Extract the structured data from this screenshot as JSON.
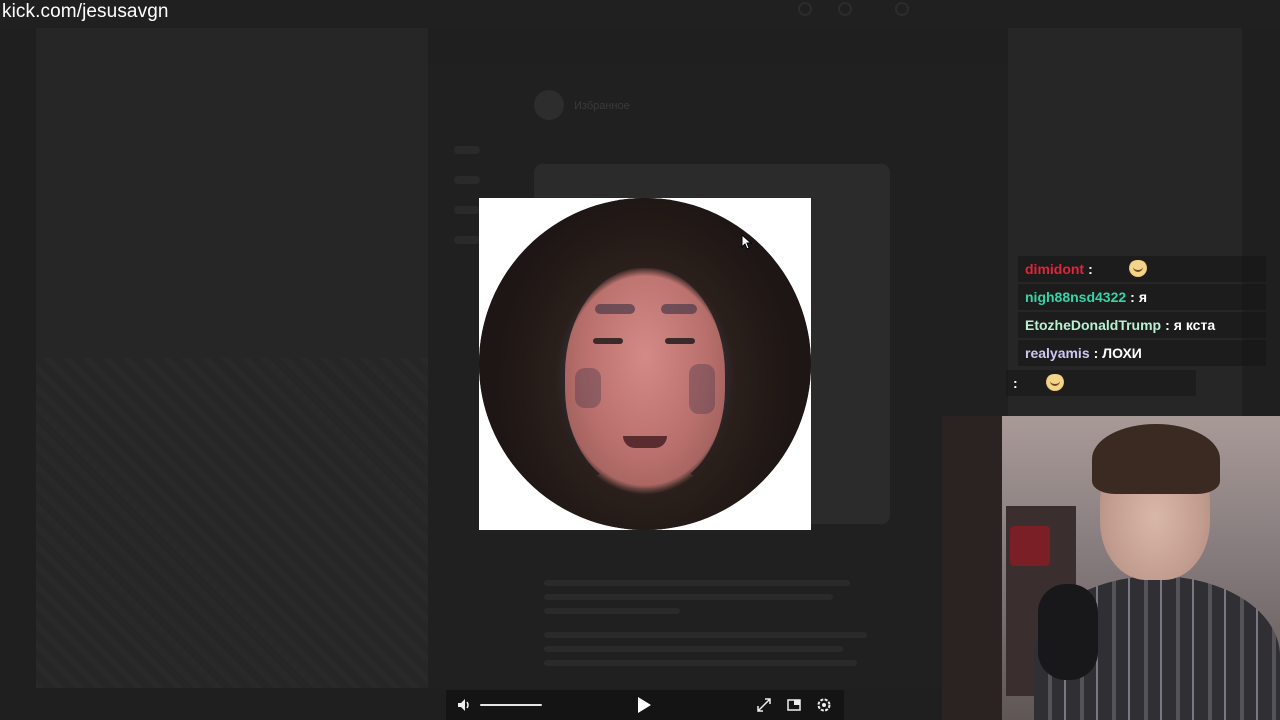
{
  "stream": {
    "url": "kick.com/jesusavgn"
  },
  "background": {
    "chat_title": "Избранное"
  },
  "player": {
    "volume_level": 0.55,
    "icons": [
      "volume-icon",
      "play-icon",
      "fullscreen-icon",
      "picture-in-picture-icon",
      "settings-icon"
    ]
  },
  "chat": {
    "messages": [
      {
        "user": "dimidont",
        "color": "#e0243a",
        "text": "",
        "emote": "smile-emote"
      },
      {
        "user": "nigh88nsd4322",
        "color": "#33d6a6",
        "text": "я",
        "emote": null
      },
      {
        "user": "EtozheDonaldTrump",
        "color": "#b9f0d0",
        "text": "я кста",
        "emote": null
      },
      {
        "user": "realyamis",
        "color": "#cfc7f3",
        "text": "ЛОХИ",
        "emote": null
      },
      {
        "user": "",
        "color": "#ffffff",
        "text": "",
        "emote": "smile-emote"
      }
    ]
  }
}
